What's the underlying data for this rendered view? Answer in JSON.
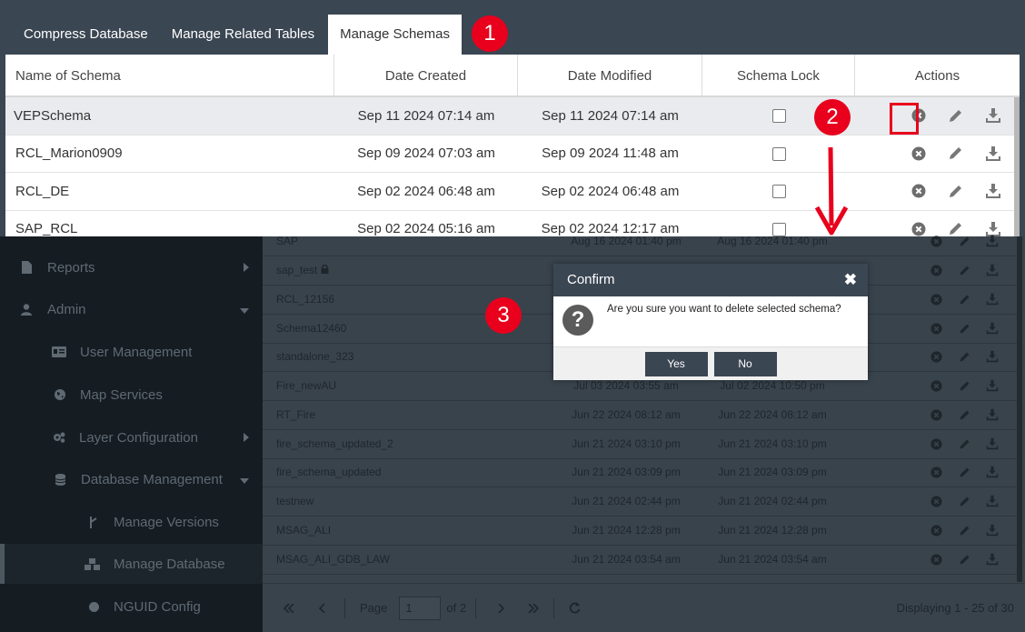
{
  "tabs": [
    "Compress Database",
    "Manage Related Tables",
    "Manage Schemas"
  ],
  "schema_table": {
    "headers": [
      "Name of Schema",
      "Date Created",
      "Date Modified",
      "Schema Lock",
      "Actions"
    ],
    "rows": [
      {
        "name": "VEPSchema",
        "created": "Sep 11 2024 07:14 am",
        "modified": "Sep 11 2024 07:14 am"
      },
      {
        "name": "RCL_Marion0909",
        "created": "Sep 09 2024 07:03 am",
        "modified": "Sep 09 2024 11:48 am"
      },
      {
        "name": "RCL_DE",
        "created": "Sep 02 2024 06:48 am",
        "modified": "Sep 02 2024 06:48 am"
      },
      {
        "name": "SAP_RCL",
        "created": "Sep 02 2024 05:16 am",
        "modified": "Sep 02 2024 12:17 am"
      }
    ]
  },
  "sidebar": {
    "items": [
      {
        "label": "Reports"
      },
      {
        "label": "Admin"
      },
      {
        "label": "User Management"
      },
      {
        "label": "Map Services"
      },
      {
        "label": "Layer Configuration"
      },
      {
        "label": "Database Management"
      },
      {
        "label": "Manage Versions"
      },
      {
        "label": "Manage Database"
      },
      {
        "label": "NGUID Config"
      }
    ]
  },
  "bg_table": {
    "rows": [
      {
        "name": "SAP",
        "created": "Aug 16 2024 01:40 pm",
        "modified": "Aug 16 2024 01:40 pm"
      },
      {
        "name": "sap_test",
        "created": "",
        "modified": ""
      },
      {
        "name": "RCL_12156",
        "created": "",
        "modified": ""
      },
      {
        "name": "Schema12460",
        "created": "",
        "modified": ""
      },
      {
        "name": "standalone_323",
        "created": "",
        "modified": ""
      },
      {
        "name": "Fire_newAU",
        "created": "Jul 03 2024 03:55 am",
        "modified": "Jul 02 2024 10:50 pm"
      },
      {
        "name": "RT_Fire",
        "created": "Jun 22 2024 08:12 am",
        "modified": "Jun 22 2024 08:12 am"
      },
      {
        "name": "fire_schema_updated_2",
        "created": "Jun 21 2024 03:10 pm",
        "modified": "Jun 21 2024 03:10 pm"
      },
      {
        "name": "fire_schema_updated",
        "created": "Jun 21 2024 03:09 pm",
        "modified": "Jun 21 2024 03:09 pm"
      },
      {
        "name": "testnew",
        "created": "Jun 21 2024 02:44 pm",
        "modified": "Jun 21 2024 02:44 pm"
      },
      {
        "name": "MSAG_ALI",
        "created": "Jun 21 2024 12:28 pm",
        "modified": "Jun 21 2024 12:28 pm"
      },
      {
        "name": "MSAG_ALI_GDB_LAW",
        "created": "Jun 21 2024 03:54 am",
        "modified": "Jun 21 2024 03:54 am"
      }
    ]
  },
  "pager": {
    "page_label": "Page",
    "page_value": "1",
    "of_label": "of 2",
    "display_text": "Displaying 1 - 25 of 30"
  },
  "dialog": {
    "title": "Confirm",
    "close": "✖",
    "message": "Are you sure you want to delete selected schema?",
    "yes": "Yes",
    "no": "No"
  },
  "annotations": {
    "step1": "1",
    "step2": "2",
    "step3": "3"
  },
  "colors": {
    "accent_red": "#e8001c",
    "header_dark": "#3b4653"
  }
}
